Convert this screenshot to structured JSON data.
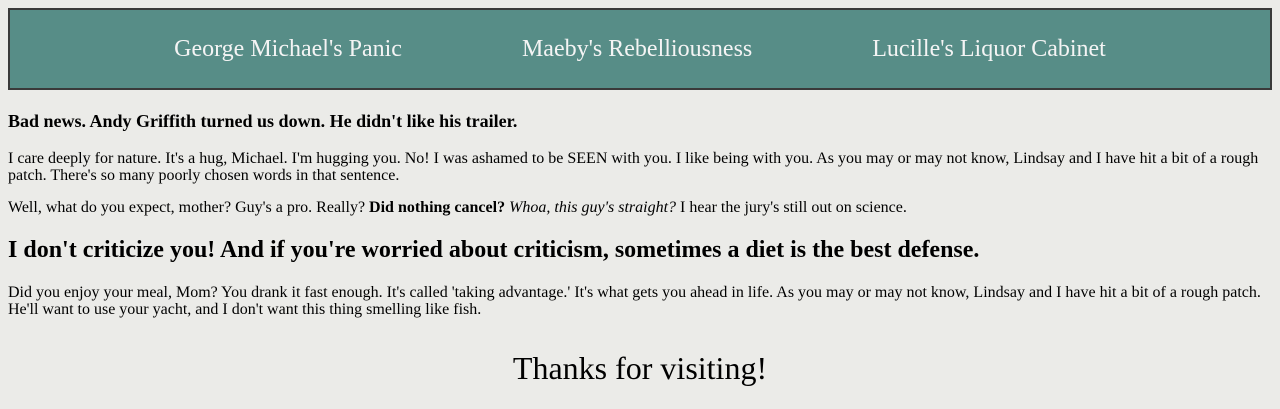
{
  "nav": {
    "items": [
      "George Michael's Panic",
      "Maeby's Rebelliousness",
      "Lucille's Liquor Cabinet"
    ]
  },
  "content": {
    "heading3": "Bad news. Andy Griffith turned us down. He didn't like his trailer.",
    "para1": "I care deeply for nature. It's a hug, Michael. I'm hugging you. No! I was ashamed to be SEEN with you. I like being with you. As you may or may not know, Lindsay and I have hit a bit of a rough patch. There's so many poorly chosen words in that sentence.",
    "para2": {
      "text1": "Well, what do you expect, mother? Guy's a pro. Really? ",
      "bold": "Did nothing cancel?",
      "space1": " ",
      "italic": "Whoa, this guy's straight?",
      "text2": " I hear the jury's still out on science."
    },
    "heading2": "I don't criticize you! And if you're worried about criticism, sometimes a diet is the best defense.",
    "para3": "Did you enjoy your meal, Mom? You drank it fast enough. It's called 'taking advantage.' It's what gets you ahead in life. As you may or may not know, Lindsay and I have hit a bit of a rough patch. He'll want to use your yacht, and I don't want this thing smelling like fish."
  },
  "footer": {
    "text": "Thanks for visiting!"
  }
}
